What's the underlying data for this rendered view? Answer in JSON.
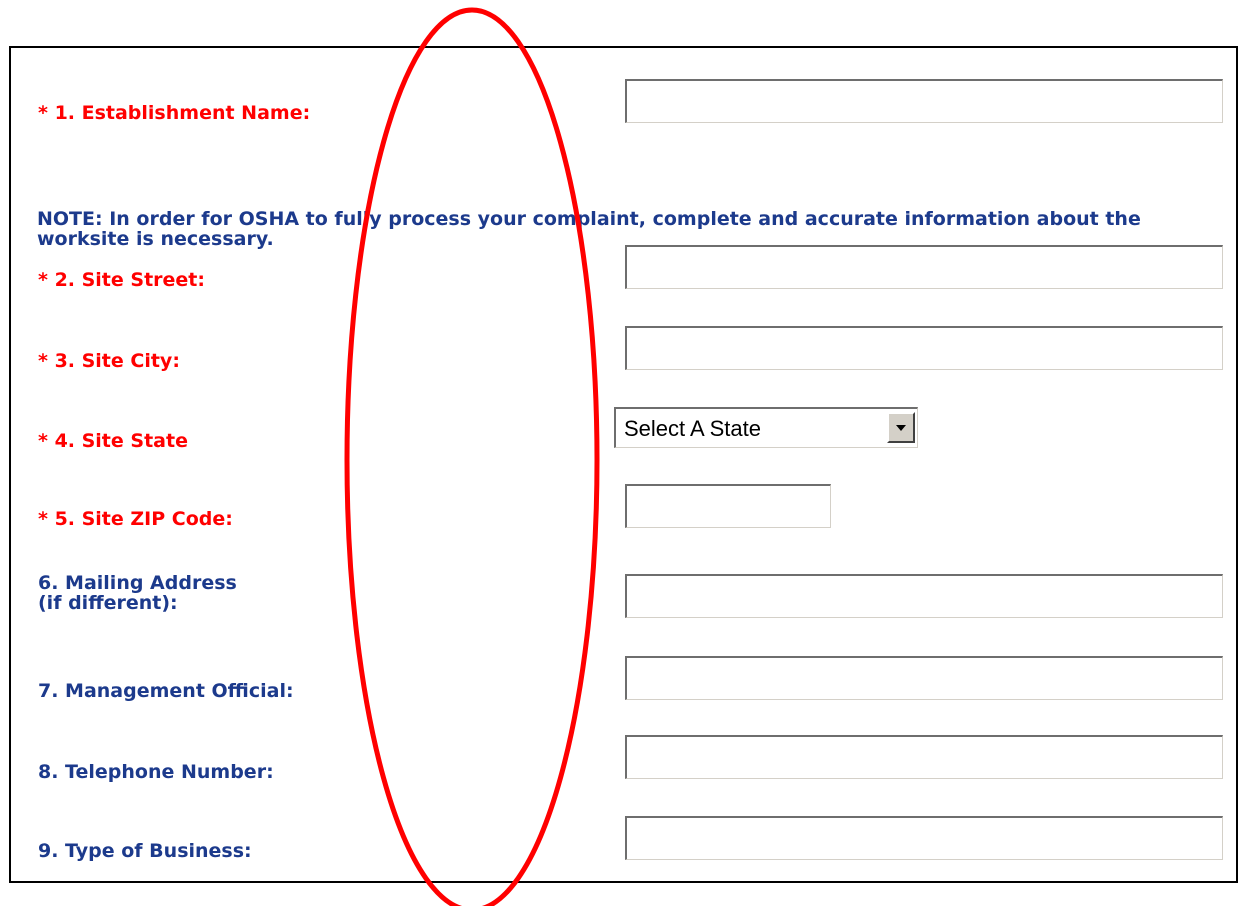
{
  "form": {
    "establishment_name": {
      "asterisk": "* ",
      "label": "1. Establishment Name:",
      "value": ""
    },
    "note": "NOTE: In order for OSHA to fully process your complaint, complete and accurate information about the worksite is necessary.",
    "site_street": {
      "asterisk": "* ",
      "label": "2. Site Street:",
      "value": ""
    },
    "site_city": {
      "asterisk": "* ",
      "label": "3. Site City:",
      "value": ""
    },
    "site_state": {
      "asterisk": "* ",
      "label": "4. Site State",
      "selected": "Select A State"
    },
    "site_zip": {
      "asterisk": "* ",
      "label": "5. Site ZIP Code:",
      "value": ""
    },
    "mailing_address": {
      "label_line1": "6. Mailing Address",
      "label_line2": "(if different):",
      "value": ""
    },
    "management_official": {
      "label": "7. Management Official:",
      "value": ""
    },
    "telephone": {
      "label": "8. Telephone Number:",
      "value": ""
    },
    "business_type": {
      "label": "9. Type of Business:",
      "value": ""
    }
  },
  "colors": {
    "required_label": "#ff0000",
    "label": "#1c3a8c",
    "annotation_ellipse": "#ff0000"
  },
  "icons": {
    "dropdown": "triangle-down-icon"
  }
}
